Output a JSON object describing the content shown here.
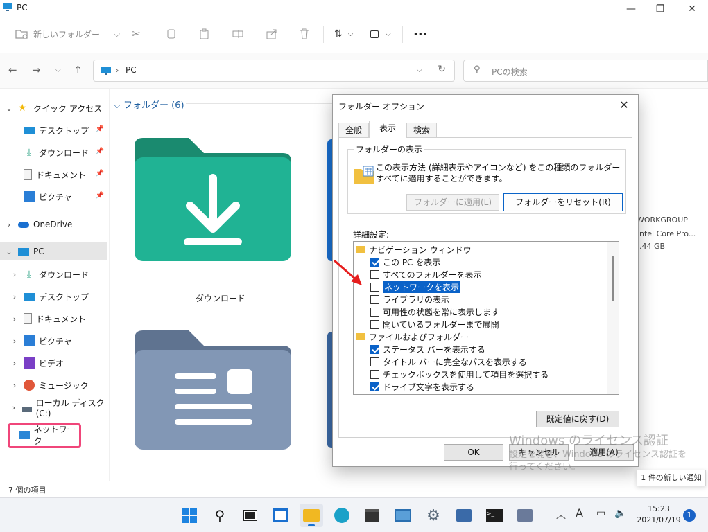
{
  "window": {
    "title": "PC"
  },
  "toolbar": {
    "new_folder_label": "新しいフォルダー"
  },
  "address": {
    "path": "PC",
    "search_placeholder": "PCの検索"
  },
  "sidebar": {
    "quick_access": "クイック アクセス",
    "quick_items": [
      {
        "label": "デスクトップ",
        "icon": "desktop-icon"
      },
      {
        "label": "ダウンロード",
        "icon": "download-icon"
      },
      {
        "label": "ドキュメント",
        "icon": "document-icon"
      },
      {
        "label": "ピクチャ",
        "icon": "picture-icon"
      }
    ],
    "onedrive": "OneDrive",
    "pc": "PC",
    "pc_items": [
      {
        "label": "ダウンロード",
        "icon": "download-icon"
      },
      {
        "label": "デスクトップ",
        "icon": "desktop-icon"
      },
      {
        "label": "ドキュメント",
        "icon": "document-icon"
      },
      {
        "label": "ピクチャ",
        "icon": "picture-icon"
      },
      {
        "label": "ビデオ",
        "icon": "video-icon"
      },
      {
        "label": "ミュージック",
        "icon": "music-icon"
      },
      {
        "label": "ローカル ディスク (C:)",
        "icon": "drive-icon"
      }
    ],
    "network": "ネットワーク"
  },
  "content": {
    "section_header": "フォルダー (6)",
    "folders": [
      {
        "label": "ダウンロード"
      }
    ],
    "side_info": [
      "WORKGROUP",
      "ntel Core Pro...",
      ".44 GB"
    ]
  },
  "status": {
    "item_count": "7 個の項目"
  },
  "dialog": {
    "title": "フォルダー オプション",
    "tabs": [
      "全般",
      "表示",
      "検索"
    ],
    "active_tab": "表示",
    "folder_view_group": "フォルダーの表示",
    "folder_view_text": "この表示方法 (詳細表示やアイコンなど) をこの種類のフォルダーすべてに適用することができます。",
    "apply_to_folders": "フォルダーに適用(L)",
    "reset_folders": "フォルダーをリセット(R)",
    "advanced_label": "詳細設定:",
    "tree": [
      {
        "type": "group",
        "label": "ナビゲーション ウィンドウ"
      },
      {
        "type": "check",
        "label": "この PC を表示",
        "checked": true
      },
      {
        "type": "check",
        "label": "すべてのフォルダーを表示",
        "checked": false
      },
      {
        "type": "check",
        "label": "ネットワークを表示",
        "checked": false,
        "highlighted": true
      },
      {
        "type": "check",
        "label": "ライブラリの表示",
        "checked": false
      },
      {
        "type": "check",
        "label": "可用性の状態を常に表示します",
        "checked": false
      },
      {
        "type": "check",
        "label": "開いているフォルダーまで展開",
        "checked": false
      },
      {
        "type": "group",
        "label": "ファイルおよびフォルダー"
      },
      {
        "type": "check",
        "label": "ステータス バーを表示する",
        "checked": true
      },
      {
        "type": "check",
        "label": "タイトル バーに完全なパスを表示する",
        "checked": false
      },
      {
        "type": "check",
        "label": "チェックボックスを使用して項目を選択する",
        "checked": false
      },
      {
        "type": "check",
        "label": "ドライブ文字を表示する",
        "checked": true
      }
    ],
    "restore_defaults": "既定値に戻す(D)",
    "ok": "OK",
    "cancel": "キャンセル",
    "apply": "適用(A)"
  },
  "watermark": {
    "line1": "Windows のライセンス認証",
    "line2": "設定を開き、Windows のライセンス認証を",
    "line3": "行ってください。"
  },
  "notification": {
    "toast": "1 件の新しい通知",
    "badge": "1"
  },
  "taskbar": {
    "tray_ime": "A",
    "time": "15:23",
    "date": "2021/07/19"
  },
  "colors": {
    "accent": "#0a62c8",
    "highlight_box": "#f0467a",
    "folder_green": "#1fae8e",
    "folder_gray": "#7a8ca8"
  }
}
